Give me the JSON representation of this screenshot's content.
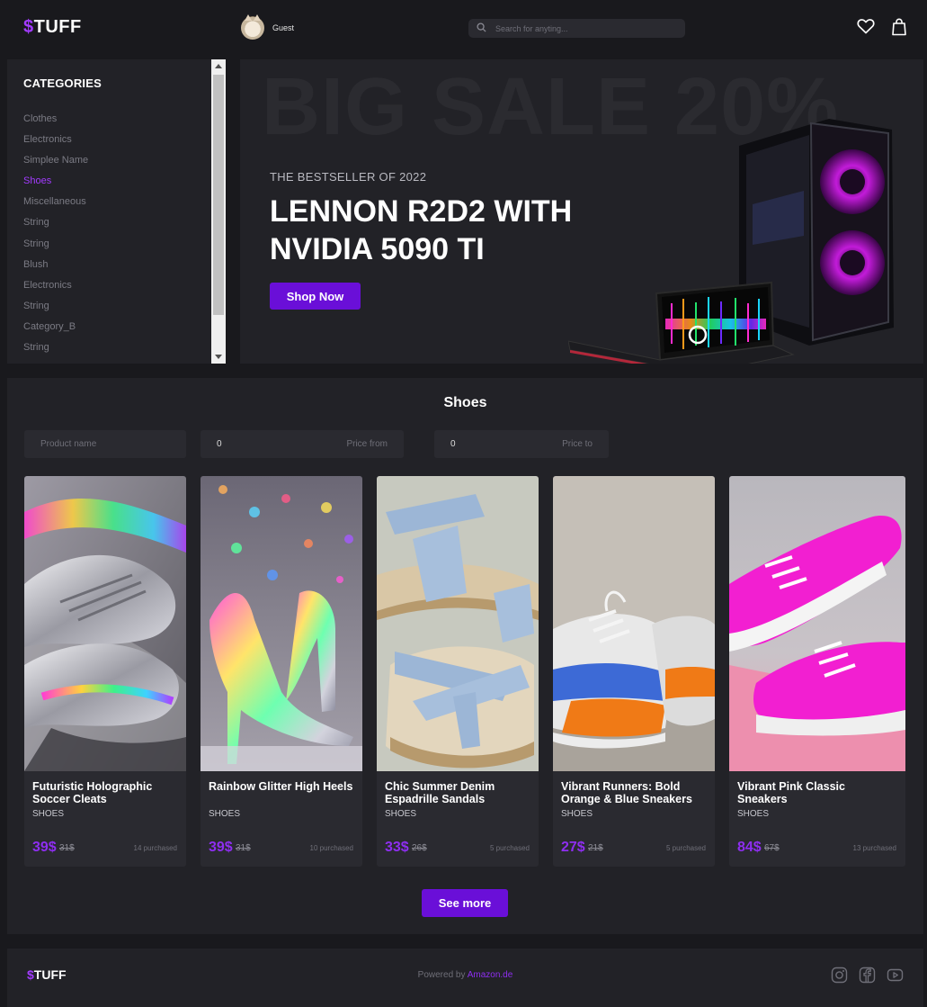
{
  "header": {
    "logo_symbol": "$",
    "logo_text": "TUFF",
    "user_name": "Guest",
    "search_placeholder": "Search for anyting..."
  },
  "sidebar": {
    "title": "CATEGORIES",
    "items": [
      "Clothes",
      "Electronics",
      "Simplee Name",
      "Shoes",
      "Miscellaneous",
      "String",
      "String",
      "Blush",
      "Electronics",
      "String",
      "Category_B",
      "String"
    ],
    "active_index": 3
  },
  "banner": {
    "background_text": "BIG SALE 20%",
    "subtitle": "THE BESTSELLER OF 2022",
    "title": "LENNON R2D2 WITH NVIDIA 5090 TI",
    "button": "Shop Now"
  },
  "products": {
    "title": "Shoes",
    "filters": {
      "name_placeholder": "Product name",
      "price_from_value": "0",
      "price_from_placeholder": "Price from",
      "price_to_value": "0",
      "price_to_placeholder": "Price to"
    },
    "items": [
      {
        "title": "Futuristic Holographic Soccer Cleats",
        "category": "SHOES",
        "price": "39$",
        "old_price": "31$",
        "purchased": "14 purchased"
      },
      {
        "title": "Rainbow Glitter High Heels",
        "category": "SHOES",
        "price": "39$",
        "old_price": "31$",
        "purchased": "10 purchased"
      },
      {
        "title": "Chic Summer Denim Espadrille Sandals",
        "category": "SHOES",
        "price": "33$",
        "old_price": "26$",
        "purchased": "5 purchased"
      },
      {
        "title": "Vibrant Runners: Bold Orange & Blue Sneakers",
        "category": "SHOES",
        "price": "27$",
        "old_price": "21$",
        "purchased": "5 purchased"
      },
      {
        "title": "Vibrant Pink Classic Sneakers",
        "category": "SHOES",
        "price": "84$",
        "old_price": "67$",
        "purchased": "13 purchased"
      }
    ],
    "see_more": "See more"
  },
  "footer": {
    "logo_symbol": "$",
    "logo_text": "TUFF",
    "powered_text": "Powered by",
    "powered_link": "Amazon.de",
    "icons": [
      "instagram-icon",
      "facebook-icon",
      "youtube-icon"
    ]
  },
  "colors": {
    "accent": "#6a0fd8",
    "accent_text": "#8e2ef0",
    "background": "#19191d",
    "panel": "#222227"
  }
}
